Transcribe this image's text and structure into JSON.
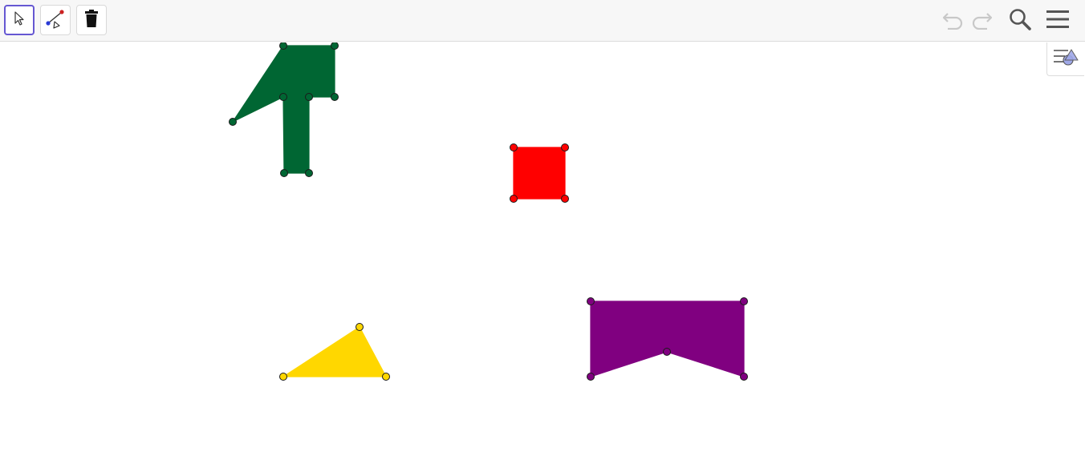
{
  "toolbar": {
    "tools": [
      {
        "name": "move-tool",
        "icon": "cursor-arrow-icon",
        "selected": true
      },
      {
        "name": "segment-tool",
        "icon": "segment-points-icon",
        "selected": false
      },
      {
        "name": "delete-tool",
        "icon": "trash-icon",
        "selected": false
      }
    ],
    "actions": [
      {
        "name": "undo",
        "icon": "undo-icon",
        "enabled": false
      },
      {
        "name": "redo",
        "icon": "redo-icon",
        "enabled": false
      },
      {
        "name": "search",
        "icon": "search-icon",
        "enabled": true
      },
      {
        "name": "menu",
        "icon": "hamburger-menu-icon",
        "enabled": true
      }
    ]
  },
  "style_bar": {
    "icon": "style-bar-toggle-icon"
  },
  "shapes": [
    {
      "name": "green-polygon",
      "fill": "#006633",
      "vertex_color": "#006633"
    },
    {
      "name": "red-square",
      "fill": "#ff0000",
      "vertex_color": "#ff0000"
    },
    {
      "name": "yellow-triangle",
      "fill": "#ffd700",
      "vertex_color": "#ffd700"
    },
    {
      "name": "purple-polygon",
      "fill": "#800080",
      "vertex_color": "#800080"
    }
  ],
  "colors": {
    "selection_accent": "#6557d2",
    "toolbar_bg": "#f7f7f7",
    "icon_dark": "#555555",
    "icon_disabled": "#c8c8c8"
  }
}
